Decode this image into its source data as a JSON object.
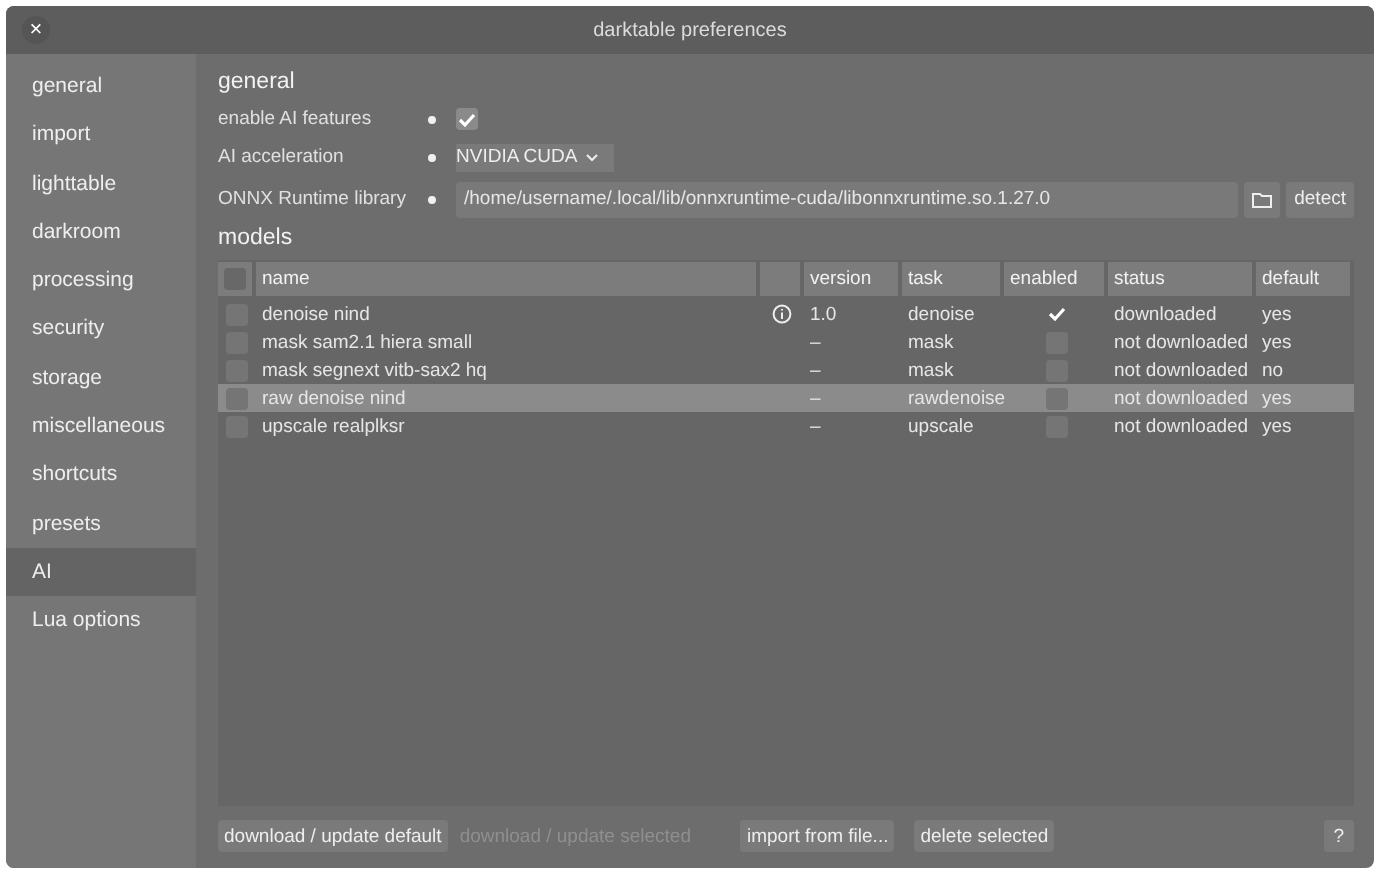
{
  "window": {
    "title": "darktable preferences",
    "close": "×"
  },
  "sidebar": {
    "items": [
      {
        "label": "general",
        "selected": false
      },
      {
        "label": "import",
        "selected": false
      },
      {
        "label": "lighttable",
        "selected": false
      },
      {
        "label": "darkroom",
        "selected": false
      },
      {
        "label": "processing",
        "selected": false
      },
      {
        "label": "security",
        "selected": false
      },
      {
        "label": "storage",
        "selected": false
      },
      {
        "label": "miscellaneous",
        "selected": false
      },
      {
        "label": "shortcuts",
        "selected": false
      },
      {
        "label": "presets",
        "selected": false
      },
      {
        "label": "AI",
        "selected": true
      },
      {
        "label": "Lua options",
        "selected": false
      }
    ]
  },
  "general": {
    "title": "general",
    "settings": [
      {
        "kind": "checkbox",
        "label": "enable AI features",
        "checked": true
      },
      {
        "kind": "dropdown",
        "label": "AI acceleration",
        "value": "NVIDIA CUDA"
      },
      {
        "kind": "path",
        "label": "ONNX Runtime library",
        "value": "/home/username/.local/lib/onnxruntime-cuda/libonnxruntime.so.1.27.0",
        "button": "detect"
      }
    ]
  },
  "models": {
    "title": "models",
    "columns": [
      "name",
      "version",
      "task",
      "enabled",
      "status",
      "default"
    ],
    "header_checked": false,
    "rows": [
      {
        "checked": false,
        "selected": false,
        "name": "denoise nind",
        "info": true,
        "version": "1.0",
        "task": "denoise",
        "enabled": true,
        "status": "downloaded",
        "default": "yes"
      },
      {
        "checked": false,
        "selected": false,
        "name": "mask sam2.1 hiera small",
        "info": false,
        "version": "–",
        "task": "mask",
        "enabled": false,
        "status": "not downloaded",
        "default": "yes"
      },
      {
        "checked": false,
        "selected": false,
        "name": "mask segnext vitb-sax2 hq",
        "info": false,
        "version": "–",
        "task": "mask",
        "enabled": false,
        "status": "not downloaded",
        "default": "no"
      },
      {
        "checked": false,
        "selected": true,
        "name": "raw denoise nind",
        "info": false,
        "version": "–",
        "task": "rawdenoise",
        "enabled": false,
        "status": "not downloaded",
        "default": "yes"
      },
      {
        "checked": false,
        "selected": false,
        "name": "upscale realplksr",
        "info": false,
        "version": "–",
        "task": "upscale",
        "enabled": false,
        "status": "not downloaded",
        "default": "yes"
      }
    ]
  },
  "buttons": [
    {
      "label": "download / update default",
      "disabled": false
    },
    {
      "label": "download / update selected",
      "disabled": true
    },
    {
      "label": "import from file...",
      "disabled": false
    },
    {
      "label": "delete selected",
      "disabled": false
    }
  ],
  "help": "?"
}
